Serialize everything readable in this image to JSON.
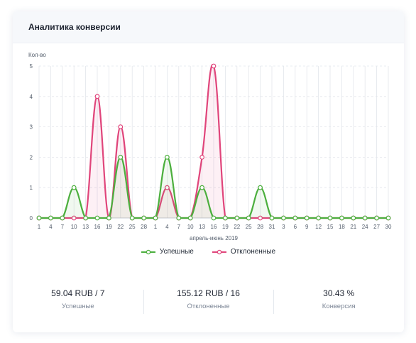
{
  "card": {
    "title": "Аналитика конверсии"
  },
  "colors": {
    "success": "#4caf3e",
    "rejected": "#e0457b",
    "grid": "#e3e6eb"
  },
  "chart_data": {
    "type": "line",
    "ylabel": "Кол-во",
    "xlabel": "апрель-июнь 2019",
    "ylim": [
      0,
      5
    ],
    "yticks": [
      0,
      1,
      2,
      3,
      4,
      5
    ],
    "categories": [
      "1",
      "4",
      "7",
      "10",
      "13",
      "16",
      "19",
      "22",
      "25",
      "28",
      "1",
      "4",
      "7",
      "10",
      "13",
      "16",
      "19",
      "22",
      "25",
      "28",
      "31",
      "3",
      "6",
      "9",
      "12",
      "15",
      "18",
      "21",
      "24",
      "27",
      "30"
    ],
    "series": [
      {
        "name": "Успешные",
        "values": [
          0,
          0,
          0,
          1,
          0,
          0,
          0,
          2,
          0,
          0,
          0,
          2,
          0,
          0,
          1,
          0,
          0,
          0,
          0,
          1,
          0,
          0,
          0,
          0,
          0,
          0,
          0,
          0,
          0,
          0,
          0
        ]
      },
      {
        "name": "Отклоненные",
        "values": [
          0,
          0,
          0,
          0,
          0,
          4,
          0,
          3,
          0,
          0,
          0,
          1,
          0,
          0,
          2,
          5,
          0,
          0,
          0,
          0,
          0,
          0,
          0,
          0,
          0,
          0,
          0,
          0,
          0,
          0,
          0
        ]
      }
    ],
    "grid": true,
    "legend_position": "bottom"
  },
  "stats": [
    {
      "value": "59.04 RUB / 7",
      "label": "Успешные"
    },
    {
      "value": "155.12 RUB / 16",
      "label": "Отклоненные"
    },
    {
      "value": "30.43 %",
      "label": "Конверсия"
    }
  ]
}
